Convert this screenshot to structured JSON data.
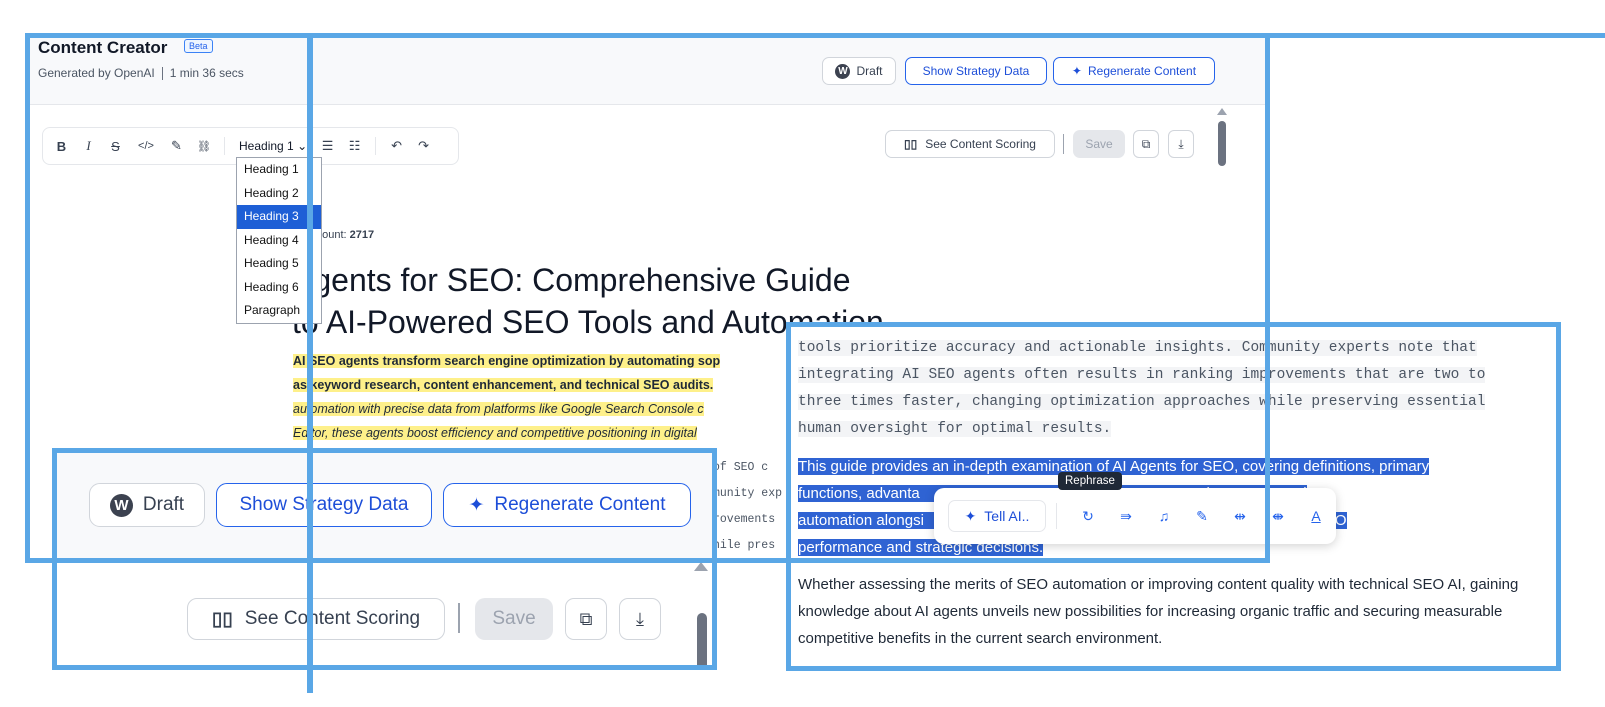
{
  "header": {
    "app_title": "Content Creator",
    "beta_badge": "Beta",
    "generated_by": "Generated by OpenAI",
    "duration": "1 min 36 secs",
    "draft_label": "Draft",
    "show_strategy_label": "Show Strategy Data",
    "regenerate_label": "Regenerate Content"
  },
  "toolbar": {
    "bold": "B",
    "italic": "I",
    "strike": "S",
    "code": "</>",
    "highlight": "✎",
    "link": "⛓",
    "heading_select": "Heading 1",
    "undo": "↶",
    "redo": "↷",
    "heading_options": [
      "Heading 1",
      "Heading 2",
      "Heading 3",
      "Heading 4",
      "Heading 5",
      "Heading 6",
      "Paragraph"
    ],
    "heading_selected_index": 2,
    "see_scoring_label": "See Content Scoring",
    "save_label": "Save"
  },
  "document": {
    "word_count_label": "Word Count:",
    "word_count_value": "2717",
    "word_count_visible_prefix": "d Count:",
    "title_line1": "Agents for SEO: Comprehensive Guide",
    "title_line2": "to AI-Powered SEO Tools and Automation",
    "lead_bold_1": "AI SEO agents transform search engine optimization by automating sop",
    "lead_bold_2": "as keyword research, content enhancement, and technical SEO audits.",
    "lead_italic_1": "automation with precise data from platforms like Google Search Console c",
    "lead_italic_2": "Editor, these agents boost efficiency and competitive positioning in digital",
    "mono_fragments": [
      "of SEO c",
      "munity exp",
      "rovements",
      "hile pres"
    ]
  },
  "zoom_header": {
    "draft_label": "Draft",
    "show_strategy_label": "Show Strategy Data",
    "regenerate_label": "Regenerate Content",
    "see_scoring_label": "See Content Scoring",
    "save_label": "Save"
  },
  "zoom_content": {
    "mono_lines": [
      "tools prioritize accuracy and actionable insights. Community experts note that",
      "integrating AI SEO agents often results in ranking improvements that are two to",
      "three times faster, changing optimization approaches while preserving essential",
      "human oversight for optimal results."
    ],
    "selected_lines": [
      "This guide provides an in-depth examination of AI Agents for SEO, covering definitions, primary",
      "functions, advanta                                                                   sing AI-powered",
      "automation alongsi                                                                   tion AI reshapes SEO",
      "performance and strategic decisions."
    ],
    "rest_text": "Whether assessing the merits of SEO automation or improving content quality with technical SEO AI, gaining knowledge about AI agents unveils new possibilities for increasing organic traffic and securing measurable competitive benefits in the current search environment.",
    "tell_ai_label": "Tell AI..",
    "tooltip": "Rephrase",
    "ai_icons": [
      "rephrase-icon",
      "expand-icon",
      "tone-icon",
      "edit-icon",
      "shorten-icon",
      "lengthen-icon",
      "text-style-icon"
    ]
  },
  "colors": {
    "frame": "#5aa7e6",
    "accent": "#2563eb",
    "selection": "#2f63d3",
    "highlight": "#fef08a"
  }
}
